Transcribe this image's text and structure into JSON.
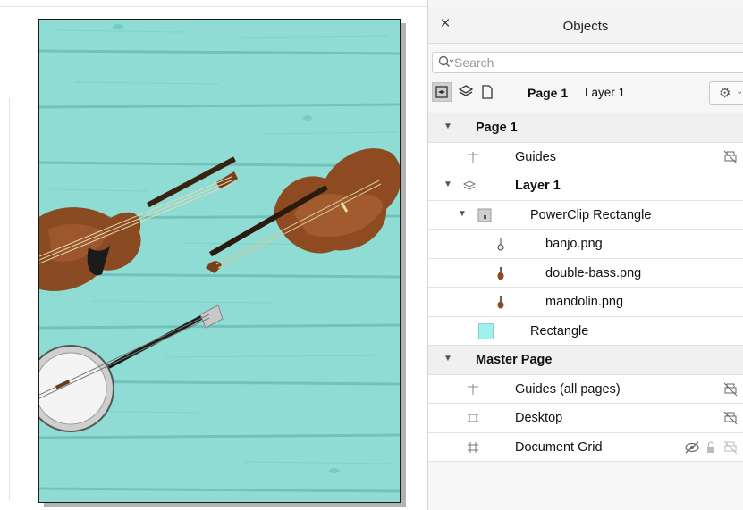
{
  "panel": {
    "title": "Objects",
    "close_icon": "×",
    "search_placeholder": "Search"
  },
  "toolbar": {
    "page_label": "Page 1",
    "layer_label": "Layer 1"
  },
  "tree": {
    "page1": "Page 1",
    "guides": "Guides",
    "layer1": "Layer 1",
    "powerclip": "PowerClip Rectangle",
    "banjo": "banjo.png",
    "bass": "double-bass.png",
    "mandolin": "mandolin.png",
    "rectangle": "Rectangle",
    "master": "Master Page",
    "guides_all": "Guides (all pages)",
    "desktop": "Desktop",
    "grid": "Document Grid"
  },
  "colors": {
    "wood_background": "#8fdcd4",
    "rectangle_swatch": "#9ff0ef",
    "instrument_brown": "#8a4a22"
  }
}
